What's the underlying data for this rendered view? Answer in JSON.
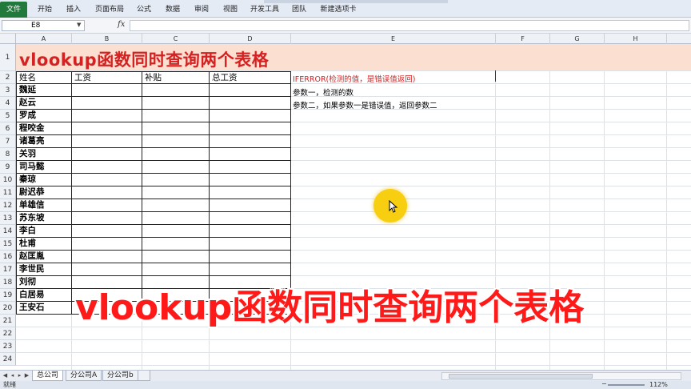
{
  "ribbon": {
    "file_tab": "文件",
    "tabs": [
      "开始",
      "插入",
      "页面布局",
      "公式",
      "数据",
      "审阅",
      "视图",
      "开发工具",
      "团队",
      "新建选项卡"
    ]
  },
  "formula_bar": {
    "name_box": "E8",
    "fx_label": "fx",
    "formula": ""
  },
  "columns": [
    "A",
    "B",
    "C",
    "D",
    "E",
    "F",
    "G",
    "H"
  ],
  "rows": [
    "1",
    "2",
    "3",
    "4",
    "5",
    "6",
    "7",
    "8",
    "9",
    "10",
    "11",
    "12",
    "13",
    "14",
    "15",
    "16",
    "17",
    "18",
    "19",
    "20",
    "21",
    "22",
    "23",
    "24"
  ],
  "sheet": {
    "title": "vlookup函数同时查询两个表格",
    "headers": [
      "姓名",
      "工资",
      "补贴",
      "总工资"
    ],
    "names": [
      "魏延",
      "赵云",
      "罗成",
      "程咬金",
      "诸葛亮",
      "关羽",
      "司马懿",
      "秦琼",
      "尉迟恭",
      "单雄信",
      "苏东坡",
      "李白",
      "杜甫",
      "赵匡胤",
      "李世民",
      "刘彻",
      "白居易",
      "王安石"
    ],
    "notes": [
      "IFERROR(检测的值，是错误值返回)",
      "参数一，检测的数",
      "参数二，如果参数一是错误值，返回参数二"
    ]
  },
  "overlay": {
    "caption": "vlookup函数同时查询两个表格"
  },
  "sheet_tabs": [
    "总公司",
    "分公司A",
    "分公司b"
  ],
  "status": {
    "ready": "就绪",
    "zoom": "112%"
  },
  "colors": {
    "title_fill": "#fbdfd1",
    "title_text": "#d42222",
    "caption_text": "#ff1a1a",
    "highlight": "#f7ce10",
    "file_tab": "#217a3c"
  }
}
